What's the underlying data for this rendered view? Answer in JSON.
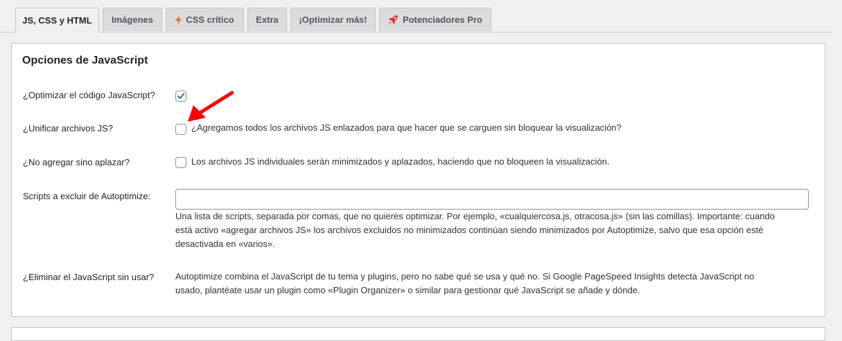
{
  "tabs": [
    {
      "label": "JS, CSS y HTML",
      "icon": ""
    },
    {
      "label": "Imágenes",
      "icon": ""
    },
    {
      "label": "CSS crítico",
      "icon": "lightning-icon"
    },
    {
      "label": "Extra",
      "icon": ""
    },
    {
      "label": "¡Optimizar más!",
      "icon": ""
    },
    {
      "label": "Potenciadores Pro",
      "icon": "rocket-icon"
    }
  ],
  "section": {
    "title": "Opciones de JavaScript"
  },
  "options": {
    "optimize": {
      "label": "¿Optimizar el código JavaScript?",
      "checked": true
    },
    "aggregate": {
      "label": "¿Unificar archivos JS?",
      "checked": false,
      "description": "¿Agregamos todos los archivos JS enlazados para que hacer que se carguen sin bloquear la visualización?"
    },
    "defer": {
      "label": "¿No agregar sino aplazar?",
      "checked": false,
      "description": "Los archivos JS individuales serán minimizados y aplazados, haciendo que no bloqueen la visualización."
    },
    "exclude": {
      "label": "Scripts a excluir de Autoptimize:",
      "value": "",
      "help_line1": "Una lista de scripts, separada por comas, que no quieres optimizar. Por ejemplo, «cualquiercosa.js, otracosa.js» (sin las comillas). Importante: cuando",
      "help_line2": "está activo «agregar archivos JS» los archivos excluidos no minimizados continúan siendo minimizados por Autoptimize, salvo que esa opción esté",
      "help_line3": "desactivada en «varios»."
    },
    "unused": {
      "label": "¿Eliminar el JavaScript sin usar?",
      "text_line1": "Autoptimize combina el JavaScript de tu tema y plugins, pero no sabe qué se usa y qué no. Si Google PageSpeed Insights detecta JavaScript no",
      "text_line2": "usado, plantéate usar un plugin como «Plugin Organizer» o similar para gestionar qué JavaScript se añade y dónde."
    }
  },
  "colors": {
    "accent": "#2271b1",
    "annotation_arrow": "#ff0000",
    "lightning": "#f56e28"
  }
}
